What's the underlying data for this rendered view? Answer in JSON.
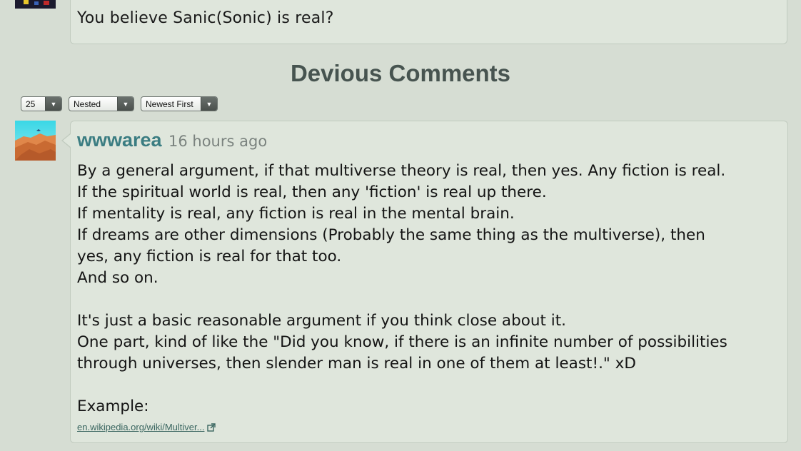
{
  "parent_comment": {
    "text": "You believe Sanic(Sonic) is real?"
  },
  "section": {
    "title": "Devious Comments"
  },
  "controls": {
    "per_page": "25",
    "view_mode": "Nested",
    "sort_order": "Newest First"
  },
  "comment": {
    "username": "wwwarea",
    "timestamp": "16 hours ago",
    "lines": [
      "By a general argument, if that multiverse theory is real, then yes. Any fiction is real.",
      "If the spiritual world is real, then any 'fiction' is real up there.",
      "If mentality is real, any fiction is real in the mental brain.",
      "If dreams are other dimensions (Probably the same thing as the multiverse), then",
      "yes, any fiction is real for that too.",
      "And so on.",
      "",
      "It's just a basic reasonable argument if you think close about it.",
      "One part, kind of like the \"Did you know, if there is an infinite number of possibilities",
      "through universes, then slender man is real in one of them at least!.\" xD",
      "",
      "Example:"
    ],
    "link_text": "en.wikipedia.org/wiki/Multiver...",
    "link_icon": "external-link-icon"
  },
  "colors": {
    "background": "#d6ddd3",
    "box": "#dfe6dc",
    "username": "#3b7d82",
    "title": "#475450"
  }
}
